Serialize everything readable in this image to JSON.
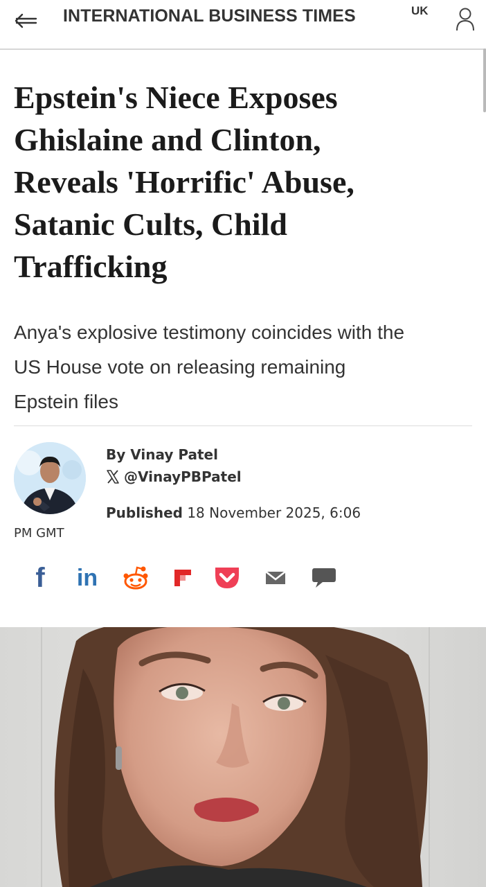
{
  "header": {
    "brand": "INTERNATIONAL BUSINESS TIMES",
    "edition": "UK",
    "back_icon": "back-arrow-icon",
    "account_icon": "user-icon"
  },
  "article": {
    "headline_lines": [
      "Epstein's Niece Exposes",
      "Ghislaine and Clinton,",
      "Reveals 'Horrific' Abuse,",
      "Satanic Cults, Child",
      "Trafficking"
    ],
    "standfirst_lines": [
      "Anya's explosive testimony coincides with the",
      "US House vote on releasing remaining",
      "Epstein files"
    ],
    "author": {
      "byline": "By Vinay Patel",
      "handle": "@VinayPBPatel"
    },
    "published_label": "Published",
    "published_date": "18 November 2025, 6:06",
    "published_tail": "PM GMT"
  },
  "share": {
    "facebook": "f",
    "linkedin": "in",
    "icons": [
      "facebook-icon",
      "linkedin-icon",
      "reddit-icon",
      "flipboard-icon",
      "pocket-icon",
      "email-icon",
      "comment-icon"
    ]
  },
  "colors": {
    "facebook": "#3a5e96",
    "linkedin": "#2f73b3",
    "reddit": "#ff5700",
    "flipboard": "#e12828",
    "pocket": "#ef3f56",
    "email": "#666666",
    "comment": "#555555"
  }
}
